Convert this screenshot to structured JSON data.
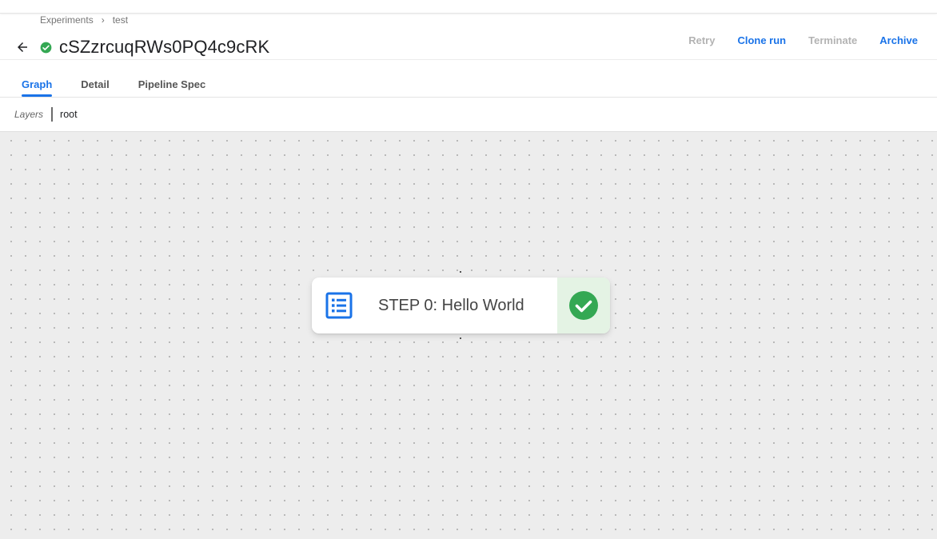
{
  "breadcrumb": {
    "items": [
      {
        "label": "Experiments"
      },
      {
        "label": "test"
      }
    ],
    "separator": "›"
  },
  "header": {
    "run_title": "cSZzrcuqRWs0PQ4c9cRK",
    "status": "succeeded",
    "status_color": "#34a853",
    "back_icon": "arrow-back-icon",
    "actions": {
      "retry": "Retry",
      "clone_run": "Clone run",
      "terminate": "Terminate",
      "archive": "Archive"
    }
  },
  "tabs": [
    {
      "label": "Graph",
      "active": true
    },
    {
      "label": "Detail",
      "active": false
    },
    {
      "label": "Pipeline Spec",
      "active": false
    }
  ],
  "layers": {
    "label": "Layers",
    "value": "root"
  },
  "graph": {
    "nodes": [
      {
        "label": "STEP 0: Hello World",
        "icon": "list-icon",
        "status": "succeeded",
        "status_icon": "check-circle-icon",
        "icon_color": "#1a73e8",
        "status_bg": "#e4f3e4"
      }
    ]
  },
  "colors": {
    "accent": "#1a73e8",
    "disabled": "#b3b3b3",
    "canvas_bg": "#ededed"
  }
}
